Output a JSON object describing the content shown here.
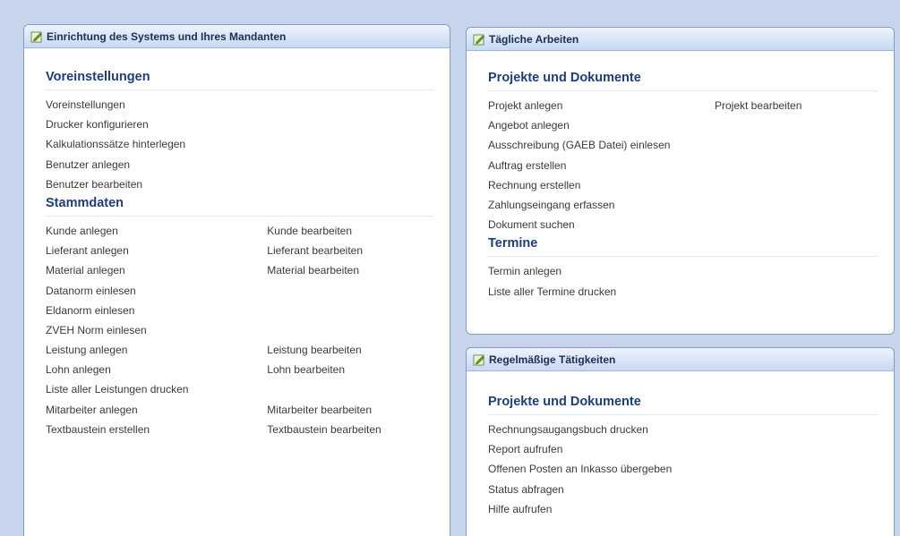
{
  "panels": {
    "setup": {
      "title": "Einrichtung des Systems und Ihres Mandanten",
      "sections": {
        "voreinstellungen": {
          "title": "Voreinstellungen",
          "rows": [
            [
              "Voreinstellungen",
              ""
            ],
            [
              "Drucker konfigurieren",
              ""
            ],
            [
              "Kalkulationssätze hinterlegen",
              ""
            ],
            [
              "Benutzer anlegen",
              ""
            ],
            [
              "Benutzer bearbeiten",
              ""
            ]
          ]
        },
        "stammdaten": {
          "title": "Stammdaten",
          "rows": [
            [
              "Kunde anlegen",
              "Kunde bearbeiten"
            ],
            [
              "Lieferant anlegen",
              "Lieferant bearbeiten"
            ],
            [
              "Material anlegen",
              "Material bearbeiten"
            ],
            [
              "Datanorm einlesen",
              ""
            ],
            [
              "Eldanorm einlesen",
              ""
            ],
            [
              "ZVEH Norm einlesen",
              ""
            ],
            [
              "Leistung anlegen",
              "Leistung bearbeiten"
            ],
            [
              "Lohn anlegen",
              "Lohn bearbeiten"
            ],
            [
              "Liste aller Leistungen drucken",
              ""
            ],
            [
              "Mitarbeiter anlegen",
              "Mitarbeiter bearbeiten"
            ],
            [
              "Textbaustein erstellen",
              "Textbaustein bearbeiten"
            ]
          ]
        }
      }
    },
    "daily": {
      "title": "Tägliche Arbeiten",
      "sections": {
        "projekte": {
          "title": "Projekte und Dokumente",
          "rows": [
            [
              "Projekt anlegen",
              "Projekt bearbeiten"
            ],
            [
              "Angebot anlegen",
              ""
            ],
            [
              "Ausschreibung (GAEB Datei) einlesen",
              ""
            ],
            [
              "Auftrag erstellen",
              ""
            ],
            [
              "Rechnung erstellen",
              ""
            ],
            [
              "Zahlungseingang erfassen",
              ""
            ],
            [
              "Dokument suchen",
              ""
            ]
          ]
        },
        "termine": {
          "title": "Termine",
          "rows": [
            [
              "Termin anlegen",
              ""
            ],
            [
              "Liste aller Termine drucken",
              ""
            ]
          ]
        }
      }
    },
    "regular": {
      "title": "Regelmäßige Tätigkeiten",
      "sections": {
        "projekte": {
          "title": "Projekte und Dokumente",
          "rows": [
            [
              "Rechnungsaugangsbuch drucken",
              ""
            ],
            [
              "Report aufrufen",
              ""
            ],
            [
              "Offenen Posten an Inkasso übergeben",
              ""
            ],
            [
              "Status abfragen",
              ""
            ],
            [
              "Hilfe aufrufen",
              ""
            ]
          ]
        }
      }
    }
  },
  "icons": {
    "panel_header_icon": "edit-note-icon"
  },
  "colors": {
    "background": "#c7d5ec",
    "section_title": "#1e3e78",
    "panel_border": "#7f9cc3"
  }
}
